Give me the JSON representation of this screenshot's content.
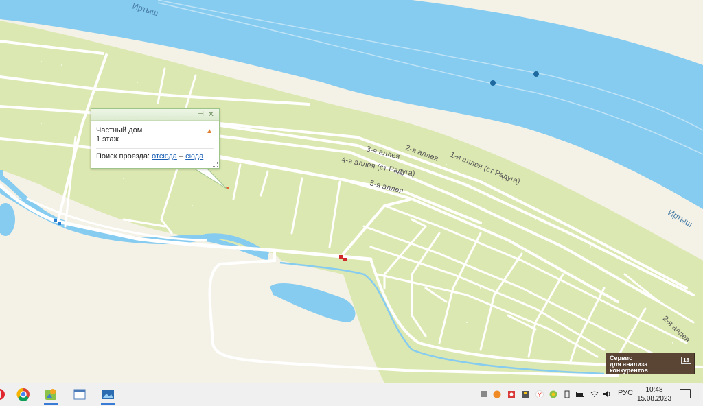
{
  "map": {
    "labels": {
      "river_top": "Иртыш",
      "river_right": "Иртыш",
      "alley1": "1-я аллея (ст Радуга)",
      "alley2": "2-я аллея",
      "alley3": "3-я аллея",
      "alley4": "4-я аллея (ст Радуга)",
      "alley5": "5-я аллея",
      "alley2b": "2-я аллея"
    },
    "colors": {
      "water": "#86cbf0",
      "land": "#dce8b1",
      "sand": "#f4f1e6",
      "road": "#ffffff"
    }
  },
  "popup": {
    "title": "Частный дом",
    "subtitle": "1 этаж",
    "route_label": "Поиск проезда:",
    "route_from": "отсюда",
    "route_dash": "–",
    "route_to": "сюда",
    "pin_icon": "pin-icon",
    "close_icon": "close-icon",
    "warn_icon": "warning-icon"
  },
  "ad": {
    "line1": "Сервис",
    "line2": "для анализа",
    "line3": "конкурентов",
    "badge": "18"
  },
  "taskbar": {
    "apps": [
      "opera-icon",
      "chrome-icon",
      "2gis-icon",
      "window-app-icon",
      "photos-icon"
    ],
    "language": "РУС",
    "time": "10:48",
    "date": "15.08.2023"
  }
}
